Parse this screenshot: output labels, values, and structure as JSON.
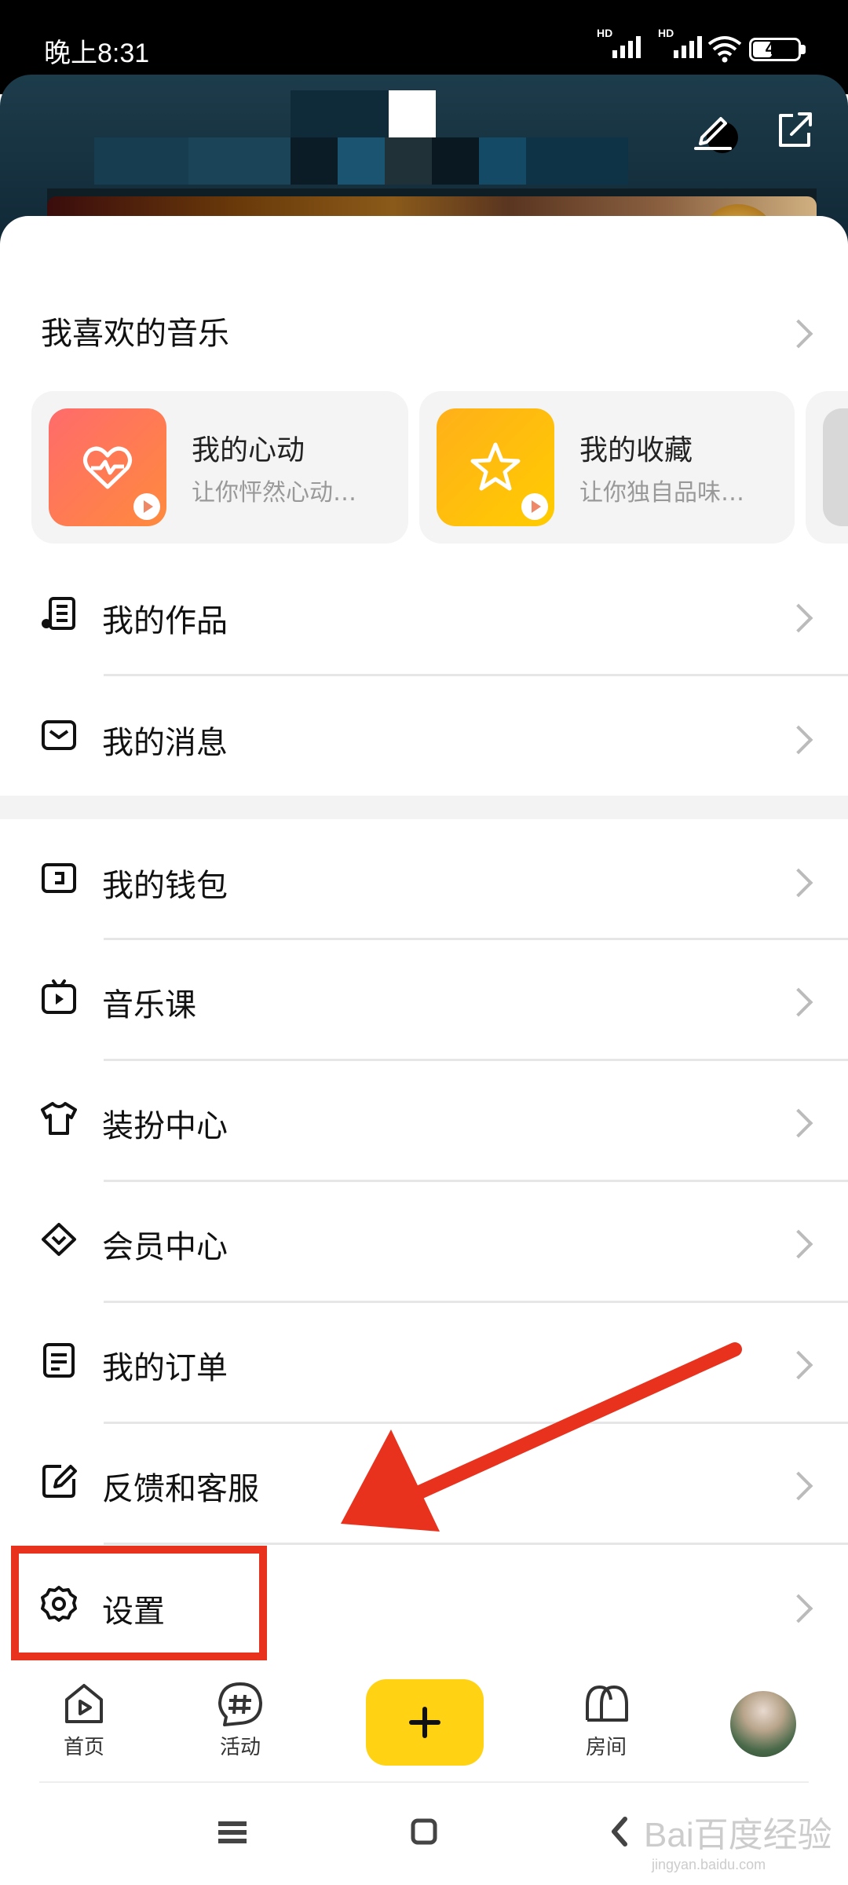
{
  "status_bar": {
    "time": "晚上8:31",
    "signal1": "HD",
    "signal2": "HD",
    "battery": "40"
  },
  "favorites": {
    "title": "我喜欢的音乐",
    "cards": [
      {
        "title": "我的心动",
        "subtitle": "让你怦然心动…",
        "color": "#ff6b6b"
      },
      {
        "title": "我的收藏",
        "subtitle": "让你独自品味…",
        "color": "#ffbe1a"
      }
    ]
  },
  "menu_group1": [
    {
      "label": "我的作品",
      "icon": "music-list-icon"
    },
    {
      "label": "我的消息",
      "icon": "mail-icon"
    }
  ],
  "menu_group2": [
    {
      "label": "我的钱包",
      "icon": "wallet-icon"
    },
    {
      "label": "音乐课",
      "icon": "video-lesson-icon"
    },
    {
      "label": "装扮中心",
      "icon": "shirt-icon"
    },
    {
      "label": "会员中心",
      "icon": "diamond-icon"
    },
    {
      "label": "我的订单",
      "icon": "order-icon"
    },
    {
      "label": "反馈和客服",
      "icon": "feedback-icon"
    },
    {
      "label": "设置",
      "icon": "gear-icon"
    }
  ],
  "bottom_nav": [
    {
      "label": "首页",
      "icon": "home-play-icon"
    },
    {
      "label": "活动",
      "icon": "hashtag-icon"
    },
    {
      "label": "",
      "icon": "plus-icon"
    },
    {
      "label": "房间",
      "icon": "room-people-icon"
    },
    {
      "label": "",
      "icon": "avatar"
    }
  ],
  "accent_color": "#ffd314",
  "annotation_color": "#e8321e",
  "watermark": {
    "brand": "Bai百度经验",
    "url": "jingyan.baidu.com"
  }
}
